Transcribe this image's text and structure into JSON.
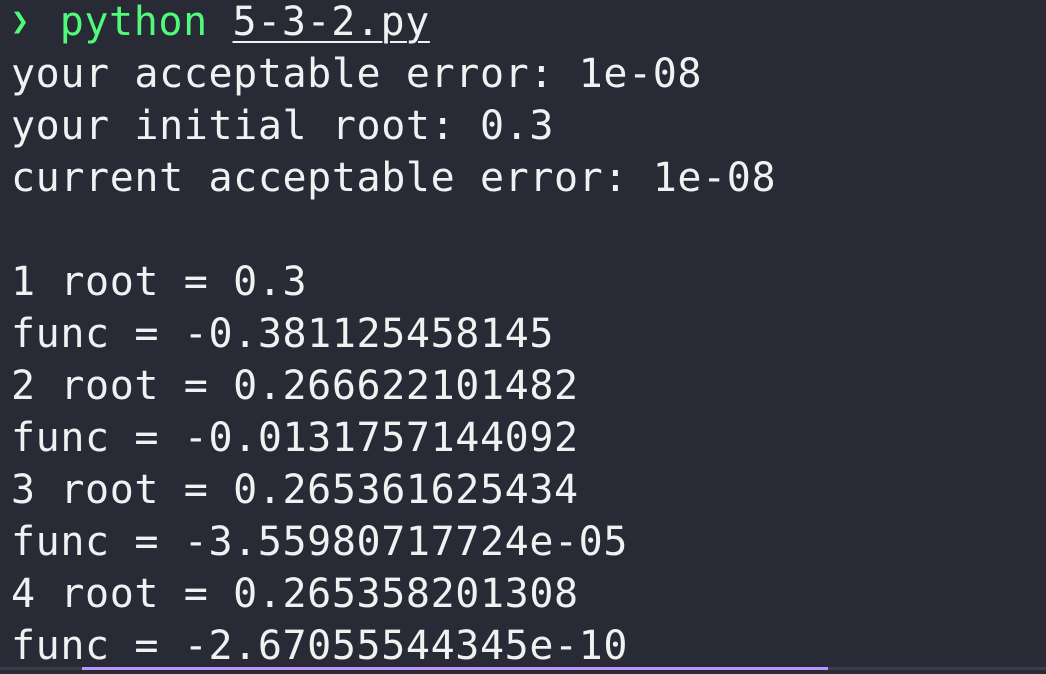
{
  "prompt": {
    "symbol": "❯",
    "command": "python",
    "argument": "5-3-2.py"
  },
  "output_lines": [
    "your acceptable error: 1e-08",
    "your initial root: 0.3",
    "current acceptable error: 1e-08",
    "",
    "1 root = 0.3",
    "func = -0.381125458145",
    "2 root = 0.266622101482",
    "func = -0.0131757144092",
    "3 root = 0.265361625434",
    "func = -3.55980717724e-05",
    "4 root = 0.265358201308",
    "func = -2.67055544345e-10"
  ],
  "colors": {
    "background": "#282a36",
    "prompt_green": "#50fa7b",
    "text": "#f1f1f1",
    "accent_bar": "#bd93f9"
  }
}
